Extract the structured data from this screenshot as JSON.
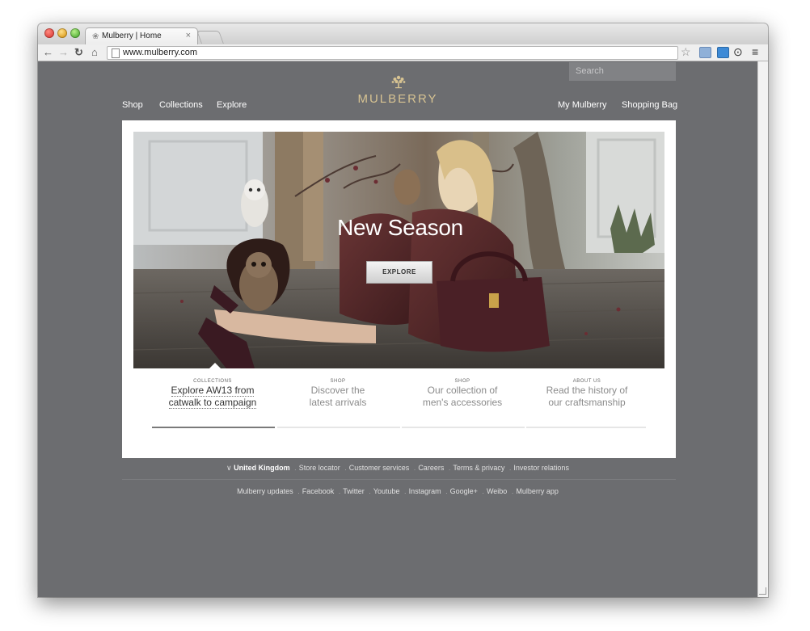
{
  "browser": {
    "tab_title": "Mulberry | Home",
    "tab_close": "×",
    "url": "www.mulberry.com"
  },
  "header": {
    "search_placeholder": "Search",
    "nav_left": [
      "Shop",
      "Collections",
      "Explore"
    ],
    "nav_right": [
      "My Mulberry",
      "Shopping Bag"
    ],
    "logo": "MULBERRY"
  },
  "hero": {
    "title": "New Season",
    "button": "EXPLORE"
  },
  "promos": [
    {
      "kicker": "COLLECTIONS",
      "line1": "Explore AW13 from",
      "line2": "catwalk to campaign"
    },
    {
      "kicker": "SHOP",
      "line1": "Discover the",
      "line2": "latest arrivals"
    },
    {
      "kicker": "SHOP",
      "line1": "Our collection of",
      "line2": "men's accessories"
    },
    {
      "kicker": "ABOUT US",
      "line1": "Read the history of",
      "line2": "our craftsmanship"
    }
  ],
  "footer": {
    "country": "United Kingdom",
    "links1": [
      "Store locator",
      "Customer services",
      "Careers",
      "Terms & privacy",
      "Investor relations"
    ],
    "links2": [
      "Mulberry updates",
      "Facebook",
      "Twitter",
      "Youtube",
      "Instagram",
      "Google+",
      "Weibo",
      "Mulberry app"
    ]
  },
  "colors": {
    "page_bg": "#6c6d70",
    "logo_gold": "#d7c392"
  }
}
